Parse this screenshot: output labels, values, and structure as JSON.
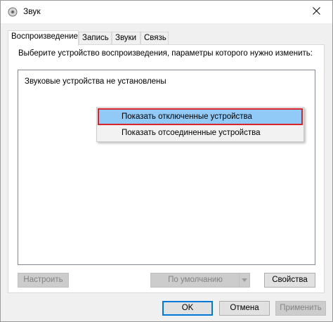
{
  "window": {
    "title": "Звук"
  },
  "tabs": [
    {
      "label": "Воспроизведение"
    },
    {
      "label": "Запись"
    },
    {
      "label": "Звуки"
    },
    {
      "label": "Связь"
    }
  ],
  "playback": {
    "instruction": "Выберите устройство воспроизведения, параметры которого нужно изменить:",
    "empty_message": "Звуковые устройства не установлены"
  },
  "context_menu": {
    "items": [
      {
        "label": "Показать отключенные устройства",
        "highlighted": true
      },
      {
        "label": "Показать отсоединенные устройства",
        "highlighted": false
      }
    ]
  },
  "panel_buttons": {
    "configure": "Настроить",
    "set_default": "По умолчанию",
    "properties": "Свойства"
  },
  "dialog_buttons": {
    "ok": "OK",
    "cancel": "Отмена",
    "apply": "Применить"
  },
  "colors": {
    "highlight_fill": "#91c9f7",
    "highlight_border": "#d8232a",
    "focus_border": "#0078d7"
  }
}
